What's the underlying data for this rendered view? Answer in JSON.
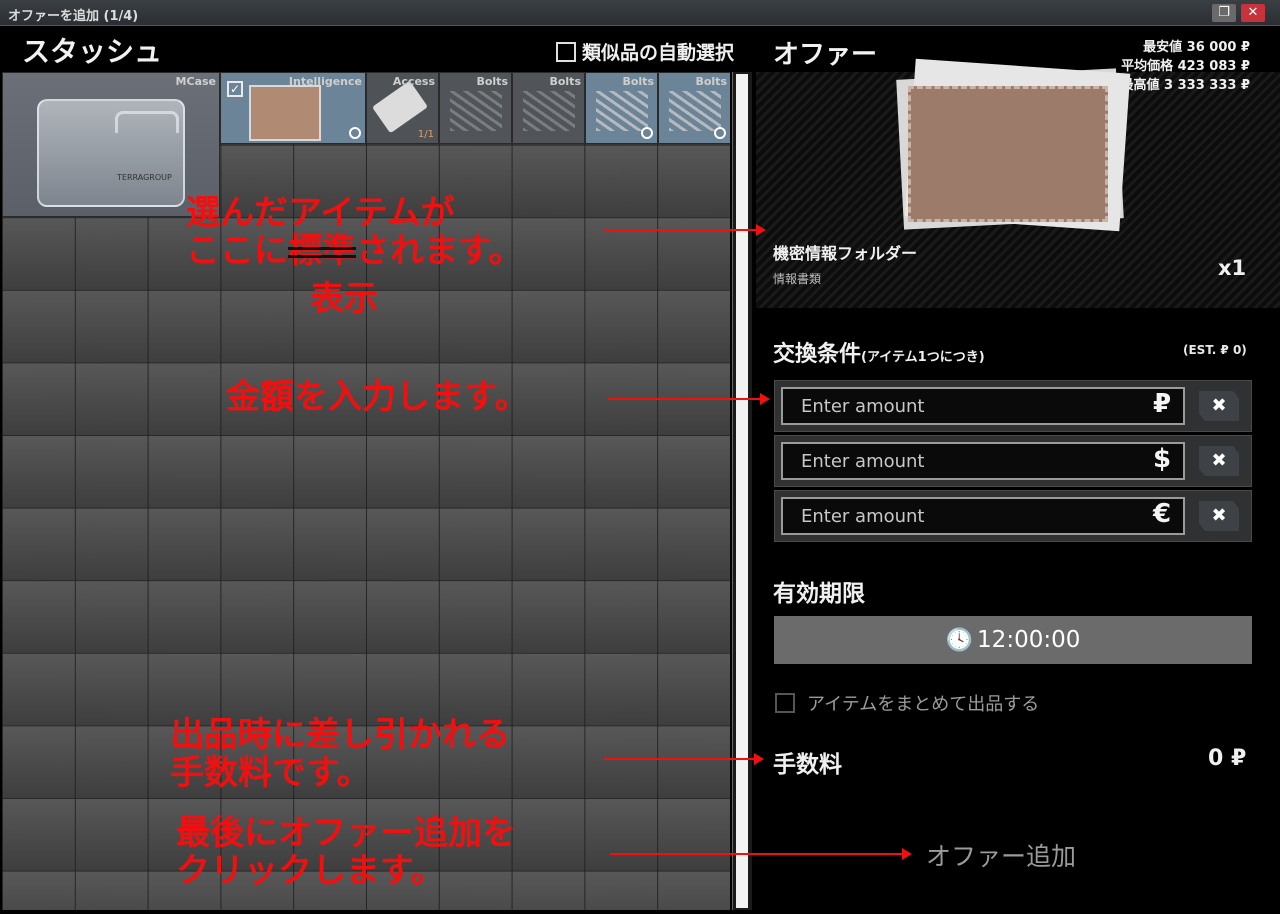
{
  "window": {
    "title": "オファーを追加 (1/4)",
    "restore_icon": "restore-icon",
    "close_icon": "close-icon"
  },
  "stash": {
    "title": "スタッシュ",
    "auto_select_label": "類似品の自動選択",
    "items": [
      {
        "label": "MCase",
        "logo": "TERRAGROUP"
      },
      {
        "label": "Intelligence",
        "checked_mark": "✓"
      },
      {
        "label": "Access",
        "count": "1/1"
      },
      {
        "label": "Bolts"
      },
      {
        "label": "Bolts"
      },
      {
        "label": "Bolts"
      },
      {
        "label": "Bolts"
      }
    ]
  },
  "offer": {
    "title": "オファー",
    "price_min": "最安値 36 000 ₽",
    "price_avg": "平均価格 423 083 ₽",
    "price_max": "最高値 3 333 333 ₽",
    "item_name": "機密情報フォルダー",
    "item_category": "情報書類",
    "quantity": "x1",
    "exchange_title": "交換条件",
    "exchange_sub": "(アイテム1つにつき)",
    "estimate": "(EST. ₽ 0)",
    "amounts": [
      {
        "placeholder": "Enter amount",
        "currency": "₽",
        "delete": "✖"
      },
      {
        "placeholder": "Enter amount",
        "currency": "$",
        "delete": "✖"
      },
      {
        "placeholder": "Enter amount",
        "currency": "€",
        "delete": "✖"
      }
    ],
    "expiry_title": "有効期限",
    "expiry_time": "12:00:00",
    "bundle_label": "アイテムをまとめて出品する",
    "fee_label": "手数料",
    "fee_value": "0 ₽",
    "add_offer_label": "オファー追加"
  },
  "annotations": {
    "a1_line1": "選んだアイテムが",
    "a1_line2_pre": "ここに",
    "a1_struck": "標準",
    "a1_line2_post": "されます。",
    "a1_line3": "表示",
    "a2": "金額を入力します。",
    "a3_line1": "出品時に差し引かれる",
    "a3_line2": "手数料です。",
    "a4_line1": "最後にオファー追加を",
    "a4_line2": "クリックします。"
  },
  "colors": {
    "accent_highlight": "#6c8497",
    "annotation_red": "#f01010"
  }
}
